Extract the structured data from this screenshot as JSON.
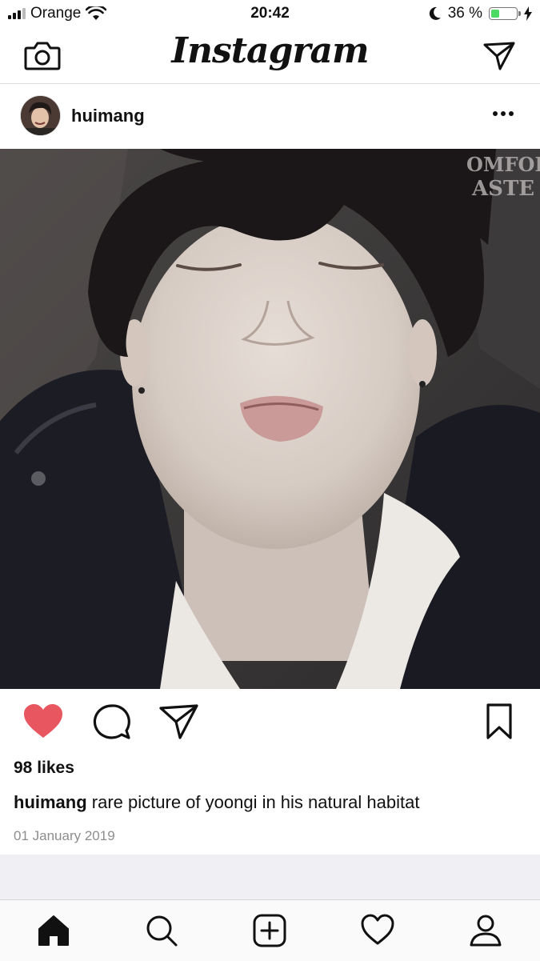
{
  "status_bar": {
    "carrier": "Orange",
    "time": "20:42",
    "battery_percent": "36 %",
    "battery_level": 0.36,
    "icons": [
      "signal-icon",
      "wifi-icon",
      "do-not-disturb-moon-icon",
      "battery-icon",
      "charging-bolt-icon"
    ]
  },
  "navbar": {
    "title": "Instagram",
    "left_icon": "camera-icon",
    "right_icon": "direct-send-icon"
  },
  "post": {
    "username": "huimang",
    "more_icon": "more-dots-icon",
    "likes": "98 likes",
    "caption_user": "huimang",
    "caption_text": " rare picture of yoongi in his natural habitat",
    "date": "01 January 2019",
    "liked": true,
    "colors": {
      "like_red": "#e8565f",
      "date_gray": "#8e8e8e",
      "feed_gap": "#efeff4"
    }
  },
  "actions": [
    "heart-icon",
    "comment-icon",
    "share-icon",
    "bookmark-icon"
  ],
  "tabbar": [
    "home-icon",
    "search-icon",
    "add-post-icon",
    "activity-heart-icon",
    "profile-icon"
  ]
}
